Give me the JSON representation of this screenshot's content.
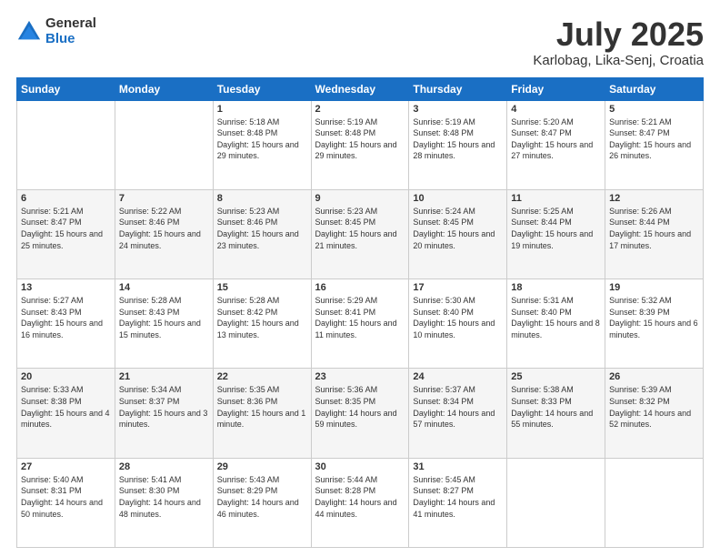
{
  "logo": {
    "general": "General",
    "blue": "Blue"
  },
  "title": "July 2025",
  "subtitle": "Karlobag, Lika-Senj, Croatia",
  "days_of_week": [
    "Sunday",
    "Monday",
    "Tuesday",
    "Wednesday",
    "Thursday",
    "Friday",
    "Saturday"
  ],
  "weeks": [
    [
      {
        "day": "",
        "info": ""
      },
      {
        "day": "",
        "info": ""
      },
      {
        "day": "1",
        "info": "Sunrise: 5:18 AM\nSunset: 8:48 PM\nDaylight: 15 hours and 29 minutes."
      },
      {
        "day": "2",
        "info": "Sunrise: 5:19 AM\nSunset: 8:48 PM\nDaylight: 15 hours and 29 minutes."
      },
      {
        "day": "3",
        "info": "Sunrise: 5:19 AM\nSunset: 8:48 PM\nDaylight: 15 hours and 28 minutes."
      },
      {
        "day": "4",
        "info": "Sunrise: 5:20 AM\nSunset: 8:47 PM\nDaylight: 15 hours and 27 minutes."
      },
      {
        "day": "5",
        "info": "Sunrise: 5:21 AM\nSunset: 8:47 PM\nDaylight: 15 hours and 26 minutes."
      }
    ],
    [
      {
        "day": "6",
        "info": "Sunrise: 5:21 AM\nSunset: 8:47 PM\nDaylight: 15 hours and 25 minutes."
      },
      {
        "day": "7",
        "info": "Sunrise: 5:22 AM\nSunset: 8:46 PM\nDaylight: 15 hours and 24 minutes."
      },
      {
        "day": "8",
        "info": "Sunrise: 5:23 AM\nSunset: 8:46 PM\nDaylight: 15 hours and 23 minutes."
      },
      {
        "day": "9",
        "info": "Sunrise: 5:23 AM\nSunset: 8:45 PM\nDaylight: 15 hours and 21 minutes."
      },
      {
        "day": "10",
        "info": "Sunrise: 5:24 AM\nSunset: 8:45 PM\nDaylight: 15 hours and 20 minutes."
      },
      {
        "day": "11",
        "info": "Sunrise: 5:25 AM\nSunset: 8:44 PM\nDaylight: 15 hours and 19 minutes."
      },
      {
        "day": "12",
        "info": "Sunrise: 5:26 AM\nSunset: 8:44 PM\nDaylight: 15 hours and 17 minutes."
      }
    ],
    [
      {
        "day": "13",
        "info": "Sunrise: 5:27 AM\nSunset: 8:43 PM\nDaylight: 15 hours and 16 minutes."
      },
      {
        "day": "14",
        "info": "Sunrise: 5:28 AM\nSunset: 8:43 PM\nDaylight: 15 hours and 15 minutes."
      },
      {
        "day": "15",
        "info": "Sunrise: 5:28 AM\nSunset: 8:42 PM\nDaylight: 15 hours and 13 minutes."
      },
      {
        "day": "16",
        "info": "Sunrise: 5:29 AM\nSunset: 8:41 PM\nDaylight: 15 hours and 11 minutes."
      },
      {
        "day": "17",
        "info": "Sunrise: 5:30 AM\nSunset: 8:40 PM\nDaylight: 15 hours and 10 minutes."
      },
      {
        "day": "18",
        "info": "Sunrise: 5:31 AM\nSunset: 8:40 PM\nDaylight: 15 hours and 8 minutes."
      },
      {
        "day": "19",
        "info": "Sunrise: 5:32 AM\nSunset: 8:39 PM\nDaylight: 15 hours and 6 minutes."
      }
    ],
    [
      {
        "day": "20",
        "info": "Sunrise: 5:33 AM\nSunset: 8:38 PM\nDaylight: 15 hours and 4 minutes."
      },
      {
        "day": "21",
        "info": "Sunrise: 5:34 AM\nSunset: 8:37 PM\nDaylight: 15 hours and 3 minutes."
      },
      {
        "day": "22",
        "info": "Sunrise: 5:35 AM\nSunset: 8:36 PM\nDaylight: 15 hours and 1 minute."
      },
      {
        "day": "23",
        "info": "Sunrise: 5:36 AM\nSunset: 8:35 PM\nDaylight: 14 hours and 59 minutes."
      },
      {
        "day": "24",
        "info": "Sunrise: 5:37 AM\nSunset: 8:34 PM\nDaylight: 14 hours and 57 minutes."
      },
      {
        "day": "25",
        "info": "Sunrise: 5:38 AM\nSunset: 8:33 PM\nDaylight: 14 hours and 55 minutes."
      },
      {
        "day": "26",
        "info": "Sunrise: 5:39 AM\nSunset: 8:32 PM\nDaylight: 14 hours and 52 minutes."
      }
    ],
    [
      {
        "day": "27",
        "info": "Sunrise: 5:40 AM\nSunset: 8:31 PM\nDaylight: 14 hours and 50 minutes."
      },
      {
        "day": "28",
        "info": "Sunrise: 5:41 AM\nSunset: 8:30 PM\nDaylight: 14 hours and 48 minutes."
      },
      {
        "day": "29",
        "info": "Sunrise: 5:43 AM\nSunset: 8:29 PM\nDaylight: 14 hours and 46 minutes."
      },
      {
        "day": "30",
        "info": "Sunrise: 5:44 AM\nSunset: 8:28 PM\nDaylight: 14 hours and 44 minutes."
      },
      {
        "day": "31",
        "info": "Sunrise: 5:45 AM\nSunset: 8:27 PM\nDaylight: 14 hours and 41 minutes."
      },
      {
        "day": "",
        "info": ""
      },
      {
        "day": "",
        "info": ""
      }
    ]
  ]
}
